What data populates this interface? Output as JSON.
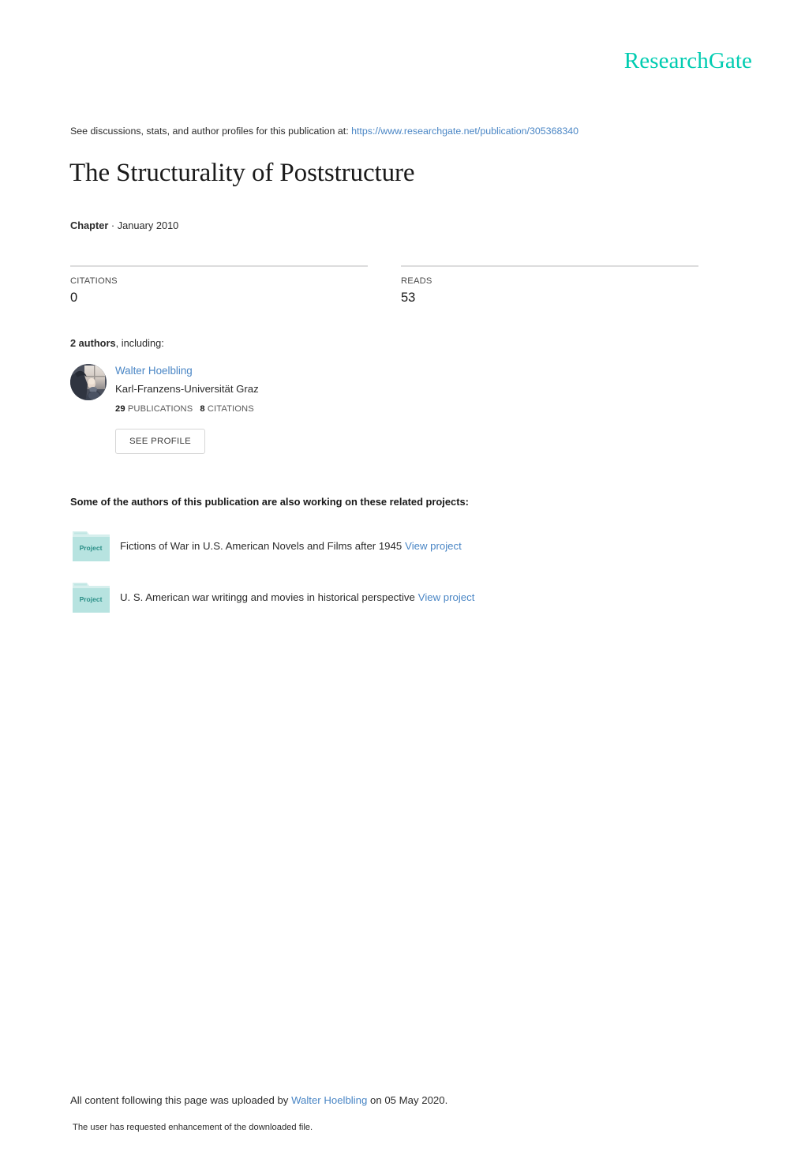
{
  "brand": {
    "name": "ResearchGate",
    "color": "#00ccb1"
  },
  "header": {
    "discussion_prefix": "See discussions, stats, and author profiles for this publication at:",
    "publication_url": "https://www.researchgate.net/publication/305368340"
  },
  "publication": {
    "title": "The Structurality of Poststructure",
    "type": "Chapter",
    "type_separator": "·",
    "date": "January 2010"
  },
  "stats": {
    "citations": {
      "label": "CITATIONS",
      "value": "0"
    },
    "reads": {
      "label": "READS",
      "value": "53"
    }
  },
  "authors": {
    "count_text": "2 authors",
    "including_text": ", including:",
    "list": [
      {
        "name": "Walter Hoelbling",
        "affiliation": "Karl-Franzens-Universität Graz",
        "publications_count": "29",
        "publications_label": "PUBLICATIONS",
        "citations_count": "8",
        "citations_label": "CITATIONS",
        "see_profile_label": "SEE PROFILE",
        "avatar_name": "author-avatar-photo"
      }
    ]
  },
  "projects": {
    "heading": "Some of the authors of this publication are also working on these related projects:",
    "icon_label": "Project",
    "items": [
      {
        "title": "Fictions of War in U.S. American Novels and Films after 1945",
        "link_label": "View project"
      },
      {
        "title": "U. S. American war writingg and movies in historical perspective",
        "link_label": "View project"
      }
    ]
  },
  "footer": {
    "upload_prefix": "All content following this page was uploaded by",
    "uploader": "Walter Hoelbling",
    "upload_suffix": "on 05 May 2020.",
    "note": "The user has requested enhancement of the downloaded file."
  },
  "colors": {
    "brand_teal": "#00ccb1",
    "link_blue": "#4a86c5",
    "text_dark": "#1a1a1a",
    "rule_gray": "#dcdcdd",
    "project_icon_body": "#b7e3e0",
    "project_icon_tab": "#d6efed",
    "project_icon_text": "#2a8f87"
  }
}
